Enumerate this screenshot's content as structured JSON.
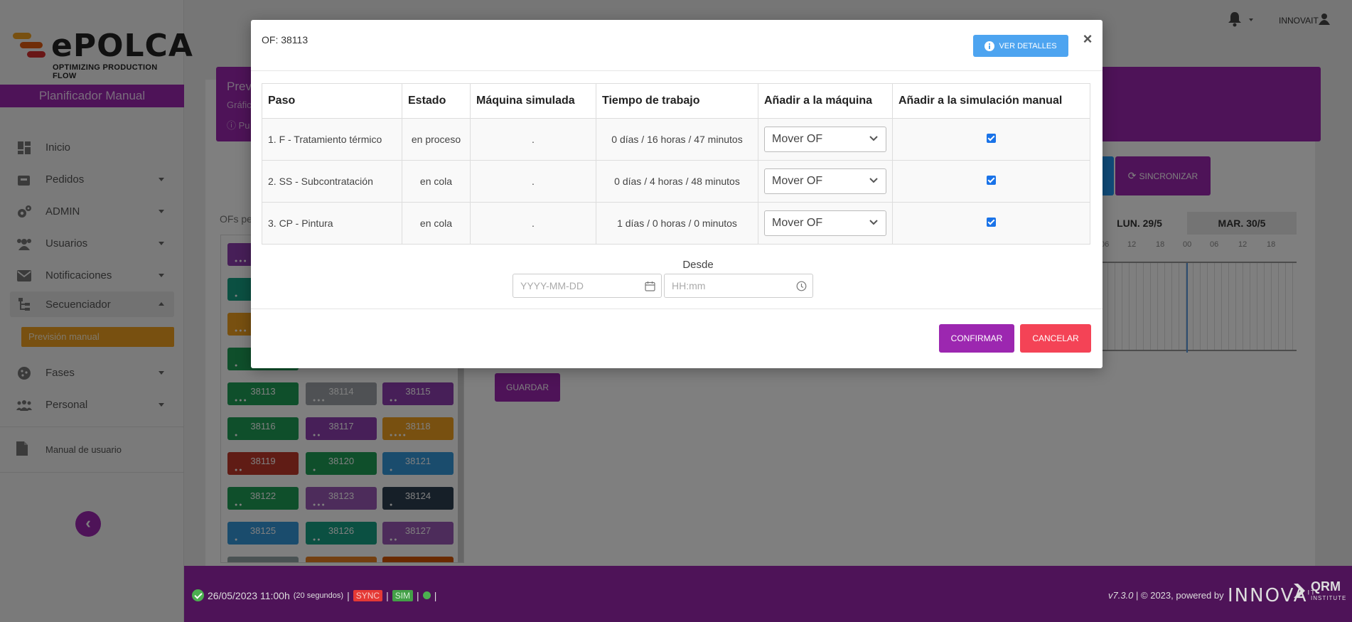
{
  "app": {
    "logo_text": "ePOLCA",
    "logo_tagline": "OPTIMIZING PRODUCTION FLOW",
    "brand_colors": {
      "primary": "#9c27b0",
      "accent_orange": "#f0a020",
      "logo_red": "#d32f2f"
    }
  },
  "sidebar": {
    "header": "Planificador Manual",
    "items": [
      {
        "label": "Inicio",
        "icon": "dashboard-icon",
        "has_caret": false
      },
      {
        "label": "Pedidos",
        "icon": "orders-icon",
        "has_caret": true
      },
      {
        "label": "ADMIN",
        "icon": "gears-icon",
        "has_caret": true
      },
      {
        "label": "Usuarios",
        "icon": "users-icon",
        "has_caret": true
      },
      {
        "label": "Notificaciones",
        "icon": "envelope-icon",
        "has_caret": true
      },
      {
        "label": "Secuenciador",
        "icon": "sitemap-icon",
        "has_caret": true,
        "open": true
      },
      {
        "label": "Fases",
        "icon": "cookie-icon",
        "has_caret": true
      },
      {
        "label": "Personal",
        "icon": "people-icon",
        "has_caret": true
      }
    ],
    "subitem_active": "Previsión manual",
    "manual": "Manual de usuario"
  },
  "topbar": {
    "user": "INNOVAIT"
  },
  "background": {
    "panel_title": "Prev",
    "panel_subtitle": "Gráfic",
    "panel_info": "Pu",
    "ofs_label": "OFs pe",
    "sync_button": "SINCRONIZAR",
    "guardar_button": "GUARDAR",
    "gantt_days": [
      "LUN. 29/5",
      "MAR. 30/5"
    ],
    "gantt_hours": [
      "06",
      "12",
      "18",
      "00",
      "06",
      "12",
      "18"
    ],
    "tiles": [
      {
        "id": "38113",
        "color": "#1e9e56",
        "dots": 3
      },
      {
        "id": "38114",
        "color": "#9ea3a8",
        "dots": 3
      },
      {
        "id": "38115",
        "color": "#8e3fb0",
        "dots": 2
      },
      {
        "id": "38116",
        "color": "#1e9e56",
        "dots": 1
      },
      {
        "id": "38117",
        "color": "#8e3fb0",
        "dots": 2
      },
      {
        "id": "38118",
        "color": "#f0a020",
        "dots": 4
      },
      {
        "id": "38119",
        "color": "#c0392b",
        "dots": 2
      },
      {
        "id": "38120",
        "color": "#1e9e56",
        "dots": 1
      },
      {
        "id": "38121",
        "color": "#3498db",
        "dots": 1
      },
      {
        "id": "38122",
        "color": "#1e9e56",
        "dots": 2
      },
      {
        "id": "38123",
        "color": "#9b59b6",
        "dots": 3
      },
      {
        "id": "38124",
        "color": "#2c3e50",
        "dots": 1
      },
      {
        "id": "38125",
        "color": "#3498db",
        "dots": 1
      },
      {
        "id": "38126",
        "color": "#16a085",
        "dots": 2
      },
      {
        "id": "38127",
        "color": "#9b59b6",
        "dots": 2
      }
    ],
    "tiles_above_colors": [
      "#8e3fb0",
      "#16a085",
      "#f0a020",
      "#1e9e56"
    ],
    "tiles_below_colors": [
      "#95a5a6",
      "#e67e22",
      "#d35400"
    ]
  },
  "modal": {
    "title": "OF: 38113",
    "details_button": "VER DETALLES",
    "close": "×",
    "columns": [
      "Paso",
      "Estado",
      "Máquina simulada",
      "Tiempo de trabajo",
      "Añadir a la máquina",
      "Añadir a la simulación manual"
    ],
    "rows": [
      {
        "paso": "1. F - Tratamiento térmico",
        "estado": "en proceso",
        "maquina": ".",
        "tiempo": "0 días / 16 horas / 47 minutos",
        "accion": "Mover OF",
        "checked": true
      },
      {
        "paso": "2. SS - Subcontratación",
        "estado": "en cola",
        "maquina": ".",
        "tiempo": "0 días / 4 horas / 48 minutos",
        "accion": "Mover OF",
        "checked": true
      },
      {
        "paso": "3. CP - Pintura",
        "estado": "en cola",
        "maquina": ".",
        "tiempo": "1 días / 0 horas / 0 minutos",
        "accion": "Mover OF",
        "checked": true
      }
    ],
    "desde_label": "Desde",
    "date_placeholder": "YYYY-MM-DD",
    "time_placeholder": "HH:mm",
    "confirm_button": "CONFIRMAR",
    "cancel_button": "CANCELAR"
  },
  "footer": {
    "datetime": "26/05/2023 11:00h",
    "interval": "(20 segundos)",
    "badge_sync": "SYNC",
    "badge_sim": "SIM",
    "version": "v7.3.0",
    "copyright": "| © 2023, powered by",
    "innova": "INNOVA",
    "innova_sup": "IT",
    "qrm": "QRM",
    "qrm_sub": "INSTITUTE"
  }
}
